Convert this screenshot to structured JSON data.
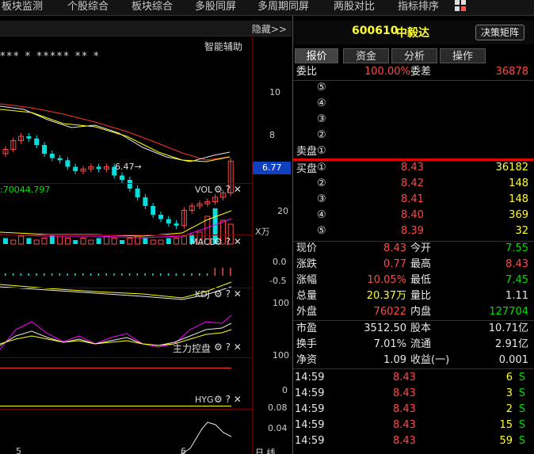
{
  "nav": {
    "items": [
      "板块监测",
      "个股综合",
      "板块综合",
      "多股同屏",
      "多周期同屏",
      "两股对比",
      "指标排序"
    ]
  },
  "chart": {
    "hide_label": "隐藏>>",
    "smart_assist": "智能辅助",
    "stars": "*** * ***** ** *",
    "low_label": "6.47→",
    "current_price_tag": "6.77",
    "y_ticks_main": [
      "10",
      "8"
    ],
    "vol_info": ":70044.797",
    "vol_label": "VOL",
    "vol_tick": "20",
    "vol_unit": "X万",
    "macd_label": "MACD",
    "macd_ticks": [
      "0.0",
      "-0.5"
    ],
    "kdj_label": "KDJ",
    "kdj_tick": "100",
    "zlkp_label": "主力控盘",
    "zlkp_ticks": [
      "100",
      "0"
    ],
    "hyg_label": "HYG",
    "hyg_ticks": [
      "0.08",
      "0.04"
    ],
    "x_ticks": [
      "5",
      "6"
    ],
    "bottom_right": "日 线",
    "tool_icons": "⚙ ? ✕"
  },
  "quote": {
    "code": "600610",
    "name": "中毅达",
    "decision_button": "决策矩阵",
    "tabs": [
      "报价",
      "资金",
      "分析",
      "操作"
    ],
    "weibi_label": "委比",
    "weibi_value": "100.00%",
    "weicha_label": "委差",
    "weicha_value": "36878",
    "sell_label": "卖盘",
    "sell_levels": [
      "⑤",
      "④",
      "③",
      "②",
      "①"
    ],
    "buy_label": "买盘",
    "buy": [
      {
        "lvl": "①",
        "price": "8.43",
        "vol": "36182"
      },
      {
        "lvl": "②",
        "price": "8.42",
        "vol": "148"
      },
      {
        "lvl": "③",
        "price": "8.41",
        "vol": "148"
      },
      {
        "lvl": "④",
        "price": "8.40",
        "vol": "369"
      },
      {
        "lvl": "⑤",
        "price": "8.39",
        "vol": "32"
      }
    ],
    "stats": [
      {
        "l1": "现价",
        "v1": "8.43",
        "c1": "red",
        "l2": "今开",
        "v2": "7.55",
        "c2": "grn"
      },
      {
        "l1": "涨跌",
        "v1": "0.77",
        "c1": "red",
        "l2": "最高",
        "v2": "8.43",
        "c2": "red"
      },
      {
        "l1": "涨幅",
        "v1": "10.05%",
        "c1": "red",
        "l2": "最低",
        "v2": "7.45",
        "c2": "grn"
      },
      {
        "l1": "总量",
        "v1": "20.37万",
        "c1": "yel",
        "l2": "量比",
        "v2": "1.11",
        "c2": "wht"
      },
      {
        "l1": "外盘",
        "v1": "76022",
        "c1": "red",
        "l2": "内盘",
        "v2": "127704",
        "c2": "grn"
      }
    ],
    "stats2": [
      {
        "l1": "市盈",
        "v1": "3512.50",
        "l2": "股本",
        "v2": "10.71亿"
      },
      {
        "l1": "换手",
        "v1": "7.01%",
        "l2": "流通",
        "v2": "2.91亿"
      },
      {
        "l1": "净资",
        "v1": "1.09",
        "l2": "收益(一)",
        "v2": "0.001"
      }
    ],
    "ticks": [
      {
        "t": "14:59",
        "p": "8.43",
        "v": "6",
        "s": "S"
      },
      {
        "t": "14:59",
        "p": "8.43",
        "v": "3",
        "s": "S"
      },
      {
        "t": "14:59",
        "p": "8.43",
        "v": "2",
        "s": "S"
      },
      {
        "t": "14:59",
        "p": "8.43",
        "v": "15",
        "s": "S"
      },
      {
        "t": "14:59",
        "p": "8.43",
        "v": "59",
        "s": "S"
      }
    ]
  },
  "colors": {
    "up": "#ff4848",
    "down": "#00e0e0",
    "ma1": "#ffffff",
    "ma2": "#ffff00",
    "ma3": "#ff00ff",
    "ma4": "#ff3030"
  }
}
